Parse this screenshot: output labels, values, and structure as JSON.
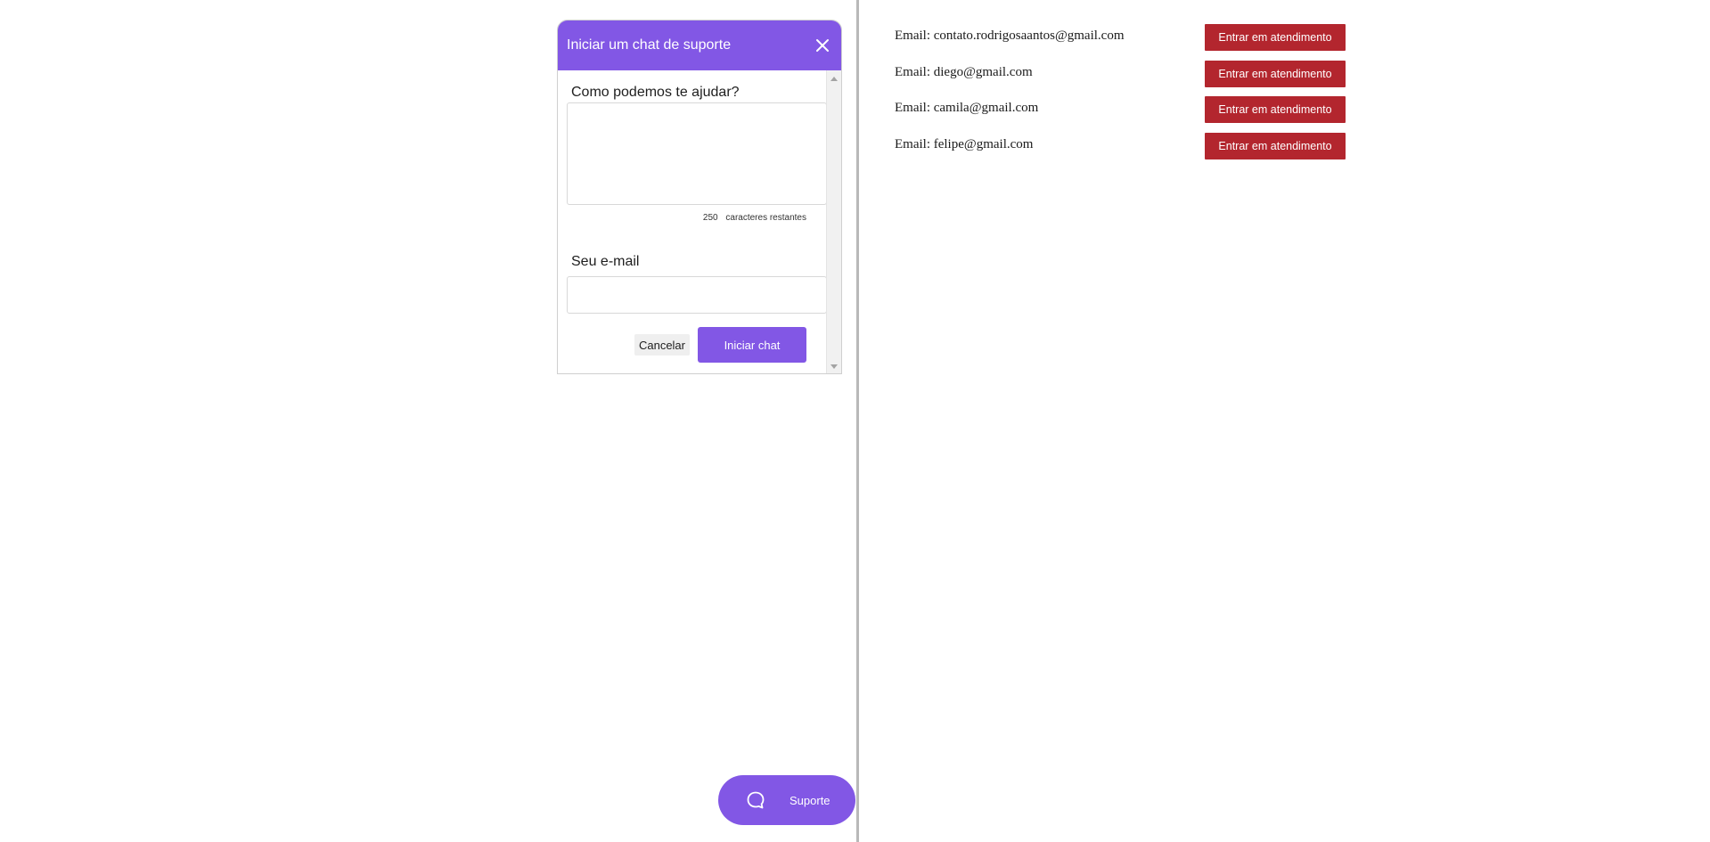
{
  "chat_widget": {
    "title": "Iniciar um chat de suporte",
    "help_label": "Como podemos te ajudar?",
    "help_value": "",
    "char_count": "250",
    "char_count_suffix": "caracteres restantes",
    "email_label": "Seu e-mail",
    "email_value": "",
    "cancel_label": "Cancelar",
    "start_label": "Iniciar chat"
  },
  "support_button": {
    "label": "Suporte"
  },
  "tickets": [
    {
      "email_text": "Email: contato.rodrigosaantos@gmail.com",
      "button_label": "Entrar em atendimento"
    },
    {
      "email_text": "Email: diego@gmail.com",
      "button_label": "Entrar em atendimento"
    },
    {
      "email_text": "Email: camila@gmail.com",
      "button_label": "Entrar em atendimento"
    },
    {
      "email_text": "Email: felipe@gmail.com",
      "button_label": "Entrar em atendimento"
    }
  ],
  "colors": {
    "brand_purple": "#8257e5",
    "attend_red": "#b3262e"
  },
  "icons": {
    "close": "close-icon",
    "chat": "chat-bubble-icon",
    "scroll_up": "caret-up-icon",
    "scroll_down": "caret-down-icon"
  }
}
